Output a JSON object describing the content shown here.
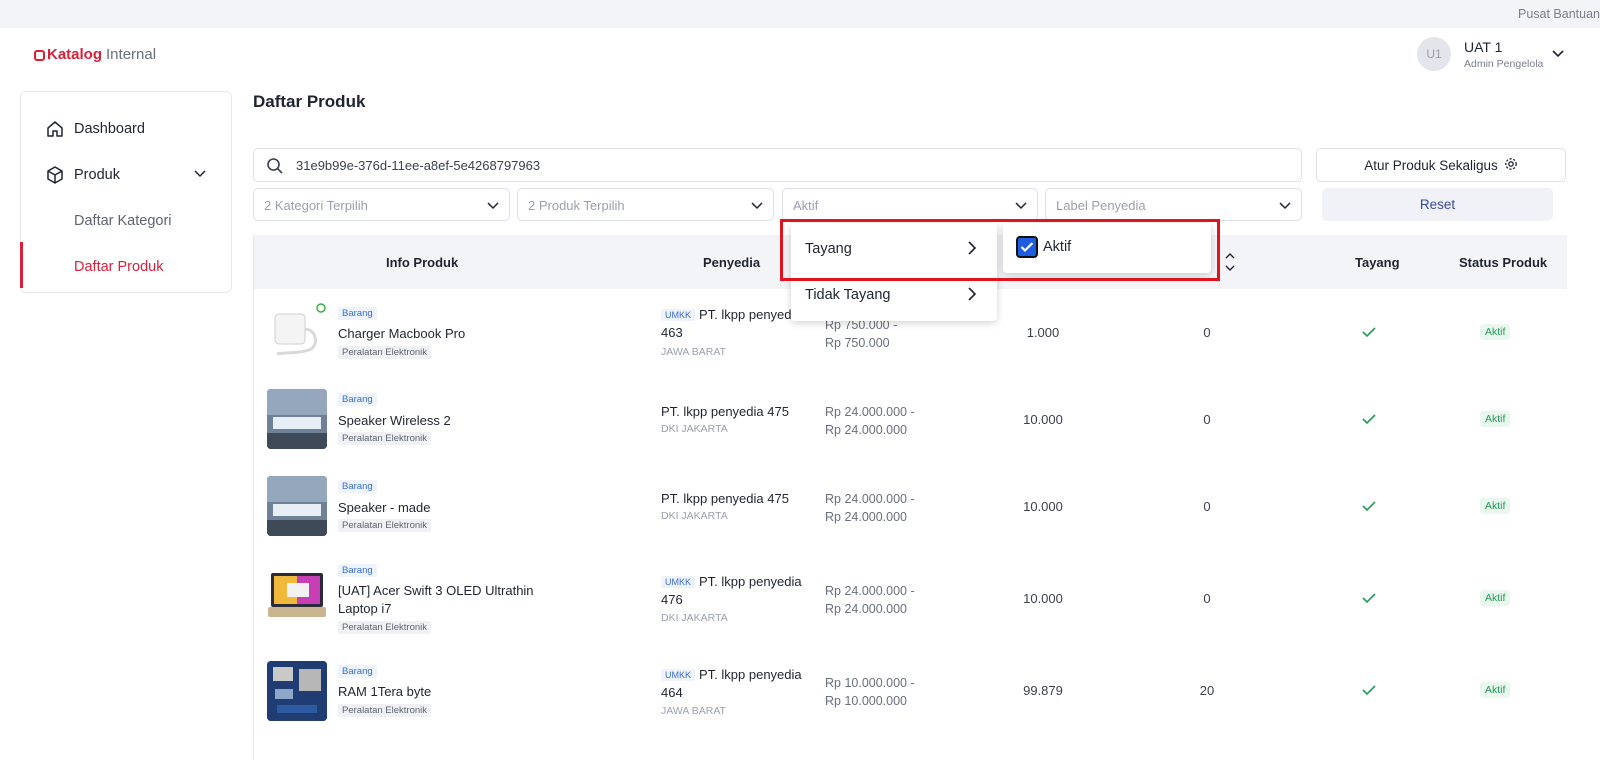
{
  "topbar": {
    "help_link": "Pusat Bantuan"
  },
  "header": {
    "brand": "Katalog",
    "brand_sub": "Internal",
    "user": {
      "initials": "U1",
      "name": "UAT 1",
      "role": "Admin Pengelola"
    }
  },
  "sidebar": {
    "items": [
      {
        "label": "Dashboard",
        "icon": "home-icon"
      },
      {
        "label": "Produk",
        "icon": "box-icon"
      }
    ],
    "sub_items": [
      {
        "label": "Daftar Kategori",
        "active": false
      },
      {
        "label": "Daftar Produk",
        "active": true
      }
    ]
  },
  "main": {
    "title": "Daftar Produk",
    "search": {
      "value": "31e9b99e-376d-11ee-a8ef-5e4268797963"
    },
    "bulk_button": "Atur Produk Sekaligus",
    "filters": {
      "category": "2 Kategori Terpilih",
      "product": "2 Produk Terpilih",
      "status": "Aktif",
      "label": "Label Penyedia"
    },
    "reset_button": "Reset"
  },
  "table": {
    "columns": {
      "info": "Info Produk",
      "vendor": "Penyedia",
      "tayang": "Tayang",
      "status": "Status Produk"
    },
    "rows": [
      {
        "type": "Barang",
        "name": "Charger Macbook Pro",
        "category": "Peralatan Elektronik",
        "umkk": "UMKK",
        "vendor": "PT. lkpp penyedia 463",
        "region": "JAWA BARAT",
        "price_min": "Rp 750.000 -",
        "price_max": "Rp 750.000",
        "stock": "1.000",
        "sold": "0",
        "status": "Aktif"
      },
      {
        "type": "Barang",
        "name": "Speaker Wireless 2",
        "category": "Peralatan Elektronik",
        "umkk": "",
        "vendor": "PT. lkpp penyedia 475",
        "region": "DKI JAKARTA",
        "price_min": "Rp 24.000.000 -",
        "price_max": "Rp 24.000.000",
        "stock": "10.000",
        "sold": "0",
        "status": "Aktif"
      },
      {
        "type": "Barang",
        "name": "Speaker - made",
        "category": "Peralatan Elektronik",
        "umkk": "",
        "vendor": "PT. lkpp penyedia 475",
        "region": "DKI JAKARTA",
        "price_min": "Rp 24.000.000 -",
        "price_max": "Rp 24.000.000",
        "stock": "10.000",
        "sold": "0",
        "status": "Aktif"
      },
      {
        "type": "Barang",
        "name": "[UAT] Acer Swift 3 OLED Ultrathin Laptop i7",
        "category": "Peralatan Elektronik",
        "umkk": "UMKK",
        "vendor": "PT. lkpp penyedia 476",
        "region": "DKI JAKARTA",
        "price_min": "Rp 24.000.000 -",
        "price_max": "Rp 24.000.000",
        "stock": "10.000",
        "sold": "0",
        "status": "Aktif"
      },
      {
        "type": "Barang",
        "name": "RAM 1Tera byte",
        "category": "Peralatan Elektronik",
        "umkk": "UMKK",
        "vendor": "PT. lkpp penyedia 464",
        "region": "JAWA BARAT",
        "price_min": "Rp 10.000.000 -",
        "price_max": "Rp 10.000.000",
        "stock": "99.879",
        "sold": "20",
        "status": "Aktif"
      }
    ]
  },
  "status_dropdown": {
    "options": [
      {
        "label": "Tayang"
      },
      {
        "label": "Tidak Tayang"
      }
    ],
    "submenu": {
      "label": "Aktif",
      "checked": true
    }
  },
  "colors": {
    "brand": "#d8203b",
    "accent_blue": "#1e5de0",
    "success": "#1f9d55",
    "highlight": "#e0141f"
  }
}
